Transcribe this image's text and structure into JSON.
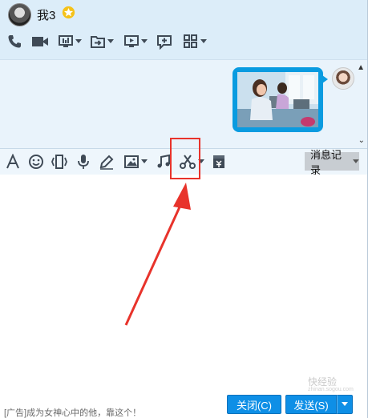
{
  "header": {
    "contact_name": "我3",
    "toolbar_icons": [
      "phone-icon",
      "video-icon",
      "screen-share-icon",
      "file-transfer-icon",
      "remote-desktop-icon",
      "add-chat-icon",
      "apps-icon"
    ]
  },
  "input_toolbar": {
    "icons": [
      "font-icon",
      "emoji-icon",
      "shake-icon",
      "voice-icon",
      "handwriting-icon",
      "image-icon",
      "music-icon",
      "scissors-icon",
      "red-packet-icon"
    ],
    "history_label": "消息记录"
  },
  "footer": {
    "ad_text": "[广告]成为女神心中的他，靠这个！",
    "close_label": "关闭(C)",
    "send_label": "发送(S)"
  },
  "watermark": {
    "text": "快经验",
    "sub": "zhinan.sogou.com"
  },
  "colors": {
    "accent": "#0e8fe6",
    "highlight": "#e8332b",
    "header_bg": "#dcedf9"
  }
}
